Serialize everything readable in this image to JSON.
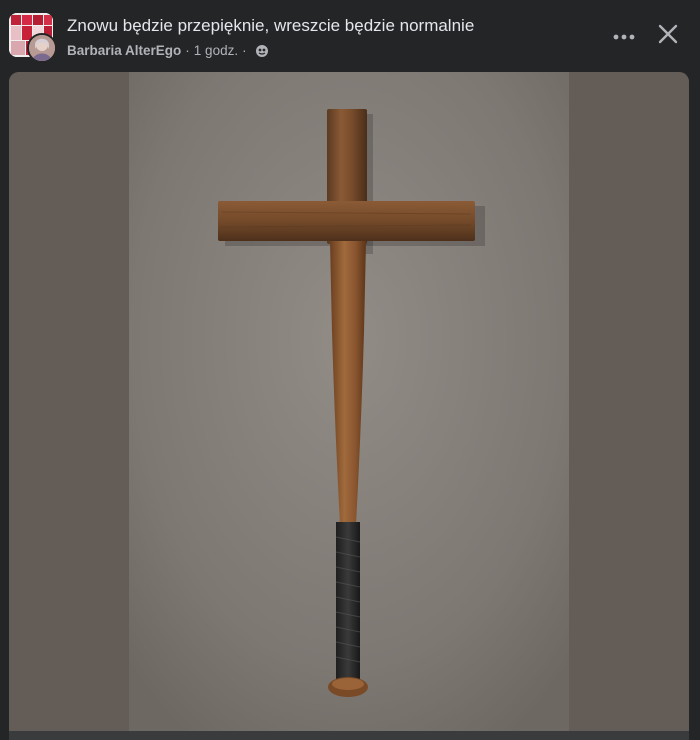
{
  "post": {
    "title": "Znowu będzie przepięknie, wreszcie będzie normalnie",
    "author": "Barbaria AlterEgo",
    "separator": "·",
    "time": "1 godz.",
    "privacy_icon": "globe-icon"
  },
  "header_actions": {
    "more_icon": "more-icon",
    "close_icon": "close-icon"
  },
  "colors": {
    "background": "#242526",
    "text_primary": "#e4e6eb",
    "text_secondary": "#b0b3b8",
    "image_side": "#645c56",
    "image_center": "#8a8580"
  }
}
